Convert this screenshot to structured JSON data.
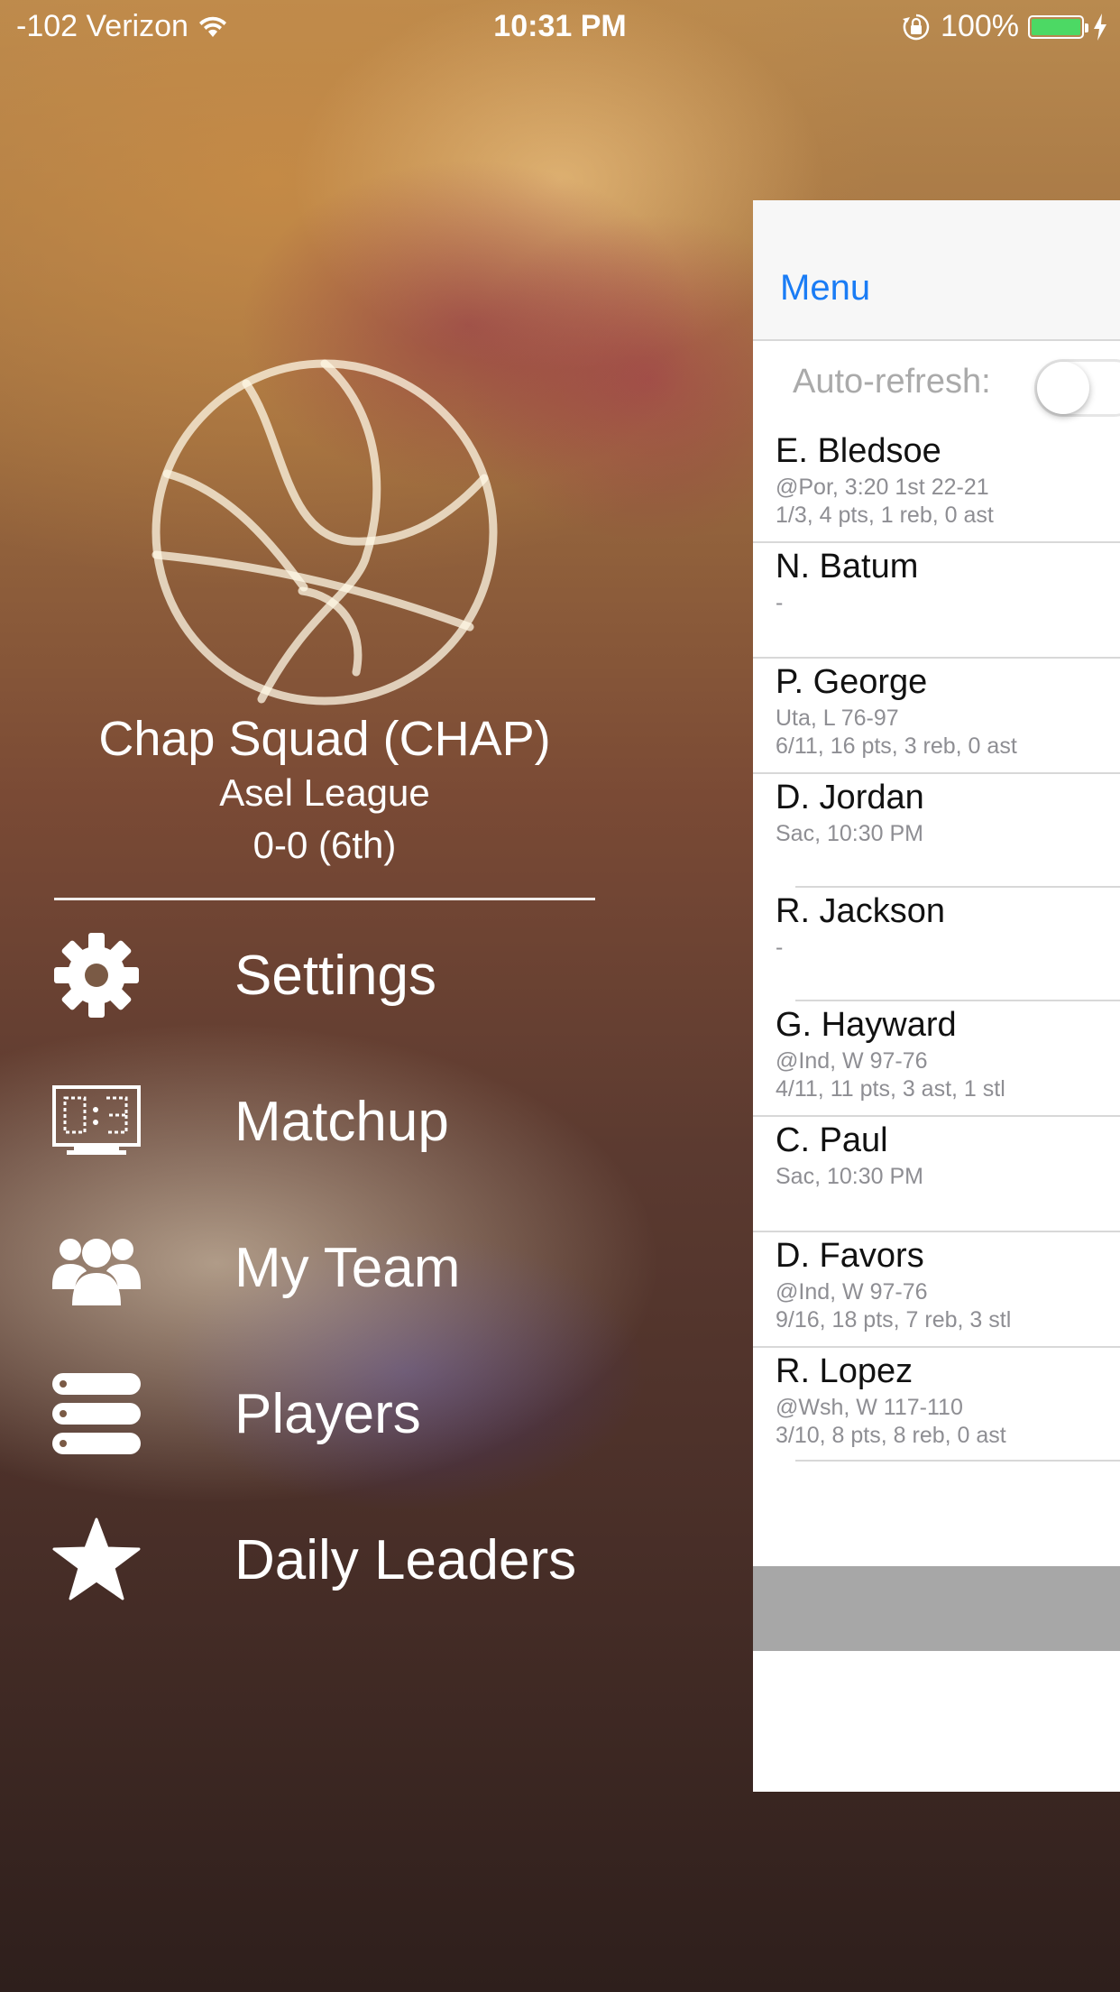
{
  "status_bar": {
    "carrier": "-102 Verizon",
    "time": "10:31 PM",
    "battery": "100%",
    "battery_color": "#4cd964"
  },
  "menu": {
    "team_name": "Chap Squad (CHAP)",
    "league": "Asel League",
    "record": "0-0 (6th)",
    "items": [
      {
        "label": "Settings",
        "icon": "gear-icon"
      },
      {
        "label": "Matchup",
        "icon": "scoreboard-icon"
      },
      {
        "label": "My Team",
        "icon": "users-icon"
      },
      {
        "label": "Players",
        "icon": "list-icon"
      },
      {
        "label": "Daily Leaders",
        "icon": "star-icon"
      }
    ]
  },
  "panel": {
    "nav_button": "Menu",
    "nav_button_color": "#1a7cf5",
    "auto_refresh_label": "Auto-refresh:",
    "auto_refresh_on": false,
    "players": [
      {
        "name": "E. Bledsoe",
        "line1": "@Por, 3:20 1st 22-21",
        "line2": "1/3, 4 pts, 1 reb, 0 ast"
      },
      {
        "name": "N. Batum",
        "line1": "-",
        "line2": ""
      },
      {
        "name": "P. George",
        "line1": "Uta, L 76-97",
        "line2": "6/11, 16 pts, 3 reb, 0 ast"
      },
      {
        "name": "D. Jordan",
        "line1": "Sac, 10:30 PM",
        "line2": ""
      },
      {
        "name": "R. Jackson",
        "line1": "-",
        "line2": ""
      },
      {
        "name": "G. Hayward",
        "line1": "@Ind, W 97-76",
        "line2": "4/11, 11 pts, 3 ast, 1 stl"
      },
      {
        "name": "C. Paul",
        "line1": "Sac, 10:30 PM",
        "line2": ""
      },
      {
        "name": "D. Favors",
        "line1": "@Ind, W 97-76",
        "line2": "9/16, 18 pts, 7 reb, 3 stl"
      },
      {
        "name": "R. Lopez",
        "line1": "@Wsh, W 117-110",
        "line2": "3/10, 8 pts, 8 reb, 0 ast"
      }
    ]
  }
}
